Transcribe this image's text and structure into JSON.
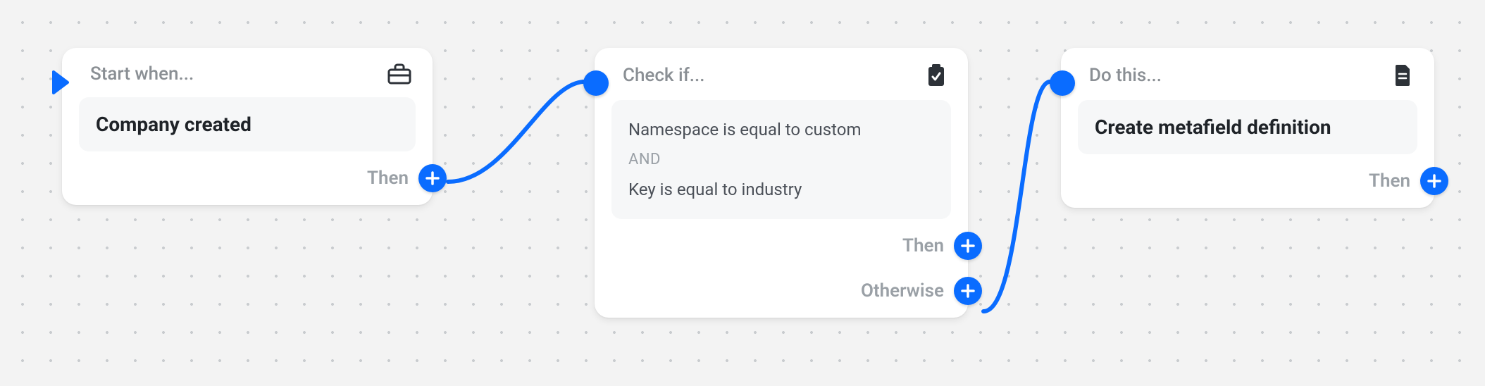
{
  "colors": {
    "accent": "#0a6cff"
  },
  "labels": {
    "then": "Then",
    "otherwise": "Otherwise"
  },
  "trigger": {
    "header": "Start when...",
    "event": "Company created"
  },
  "condition": {
    "header": "Check if...",
    "lines": [
      "Namespace is equal to custom",
      "Key is equal to industry"
    ],
    "operator": "AND"
  },
  "action": {
    "header": "Do this...",
    "name": "Create metafield definition"
  }
}
